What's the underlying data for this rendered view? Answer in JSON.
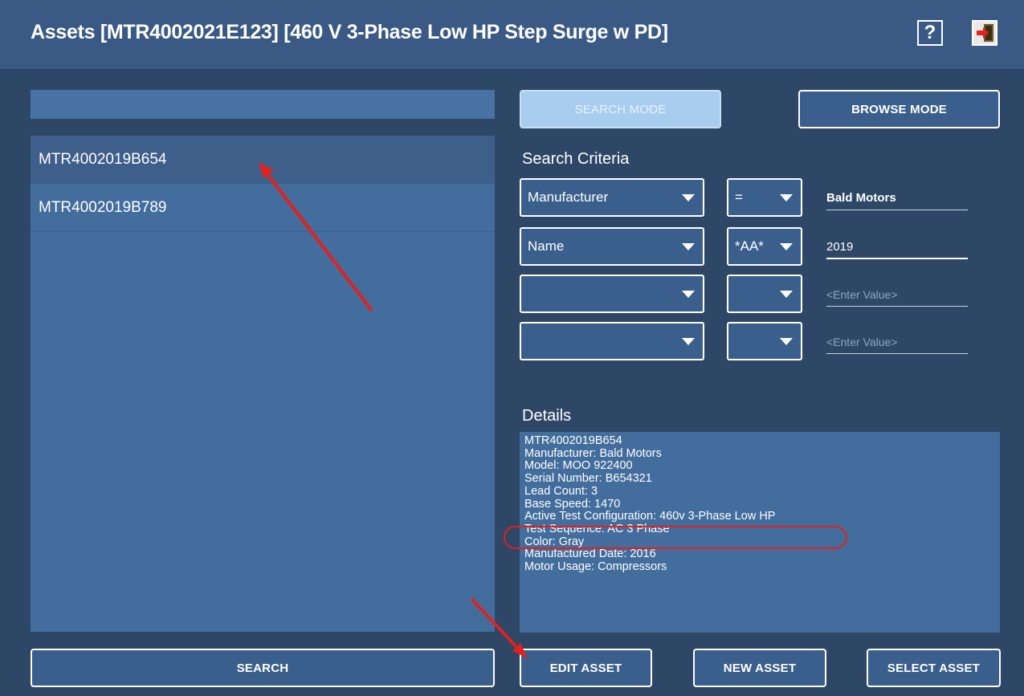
{
  "header": {
    "title": "Assets  [MTR4002021E123] [460 V 3-Phase Low HP Step Surge w PD]",
    "help_label": "?"
  },
  "search": {
    "value": ""
  },
  "asset_list": [
    {
      "id": "MTR4002019B654",
      "selected": true
    },
    {
      "id": "MTR4002019B789",
      "selected": false
    }
  ],
  "mode_buttons": {
    "search_mode": "SEARCH MODE",
    "browse_mode": "BROWSE MODE"
  },
  "criteria": {
    "title": "Search Criteria",
    "rows": [
      {
        "field": "Manufacturer",
        "op": "=",
        "value": "Bald Motors",
        "placeholder": false
      },
      {
        "field": "Name",
        "op": "*AA*",
        "value": "2019",
        "placeholder": false
      },
      {
        "field": "",
        "op": "",
        "value": "<Enter Value>",
        "placeholder": true
      },
      {
        "field": "",
        "op": "",
        "value": "<Enter Value>",
        "placeholder": true
      }
    ]
  },
  "details": {
    "title": "Details",
    "lines": [
      "MTR4002019B654",
      "Manufacturer: Bald Motors",
      "Model: MOO 922400",
      "Serial Number: B654321",
      "Lead Count: 3",
      "Base Speed: 1470",
      "Active Test Configuration: 460v 3-Phase Low HP",
      "Test Sequence: AC 3 Phase",
      "Color: Gray",
      "Manufactured Date: 2016",
      "Motor Usage: Compressors"
    ]
  },
  "bottom_buttons": {
    "search": "SEARCH",
    "edit_asset": "EDIT ASSET",
    "new_asset": "NEW ASSET",
    "select_asset": "SELECT ASSET"
  },
  "icons": {
    "help": "help-icon",
    "exit": "exit-door-icon"
  },
  "colors": {
    "header": "#3a5a85",
    "background": "#2e4766",
    "panel": "#436d9c",
    "annotation": "#e0221f"
  }
}
